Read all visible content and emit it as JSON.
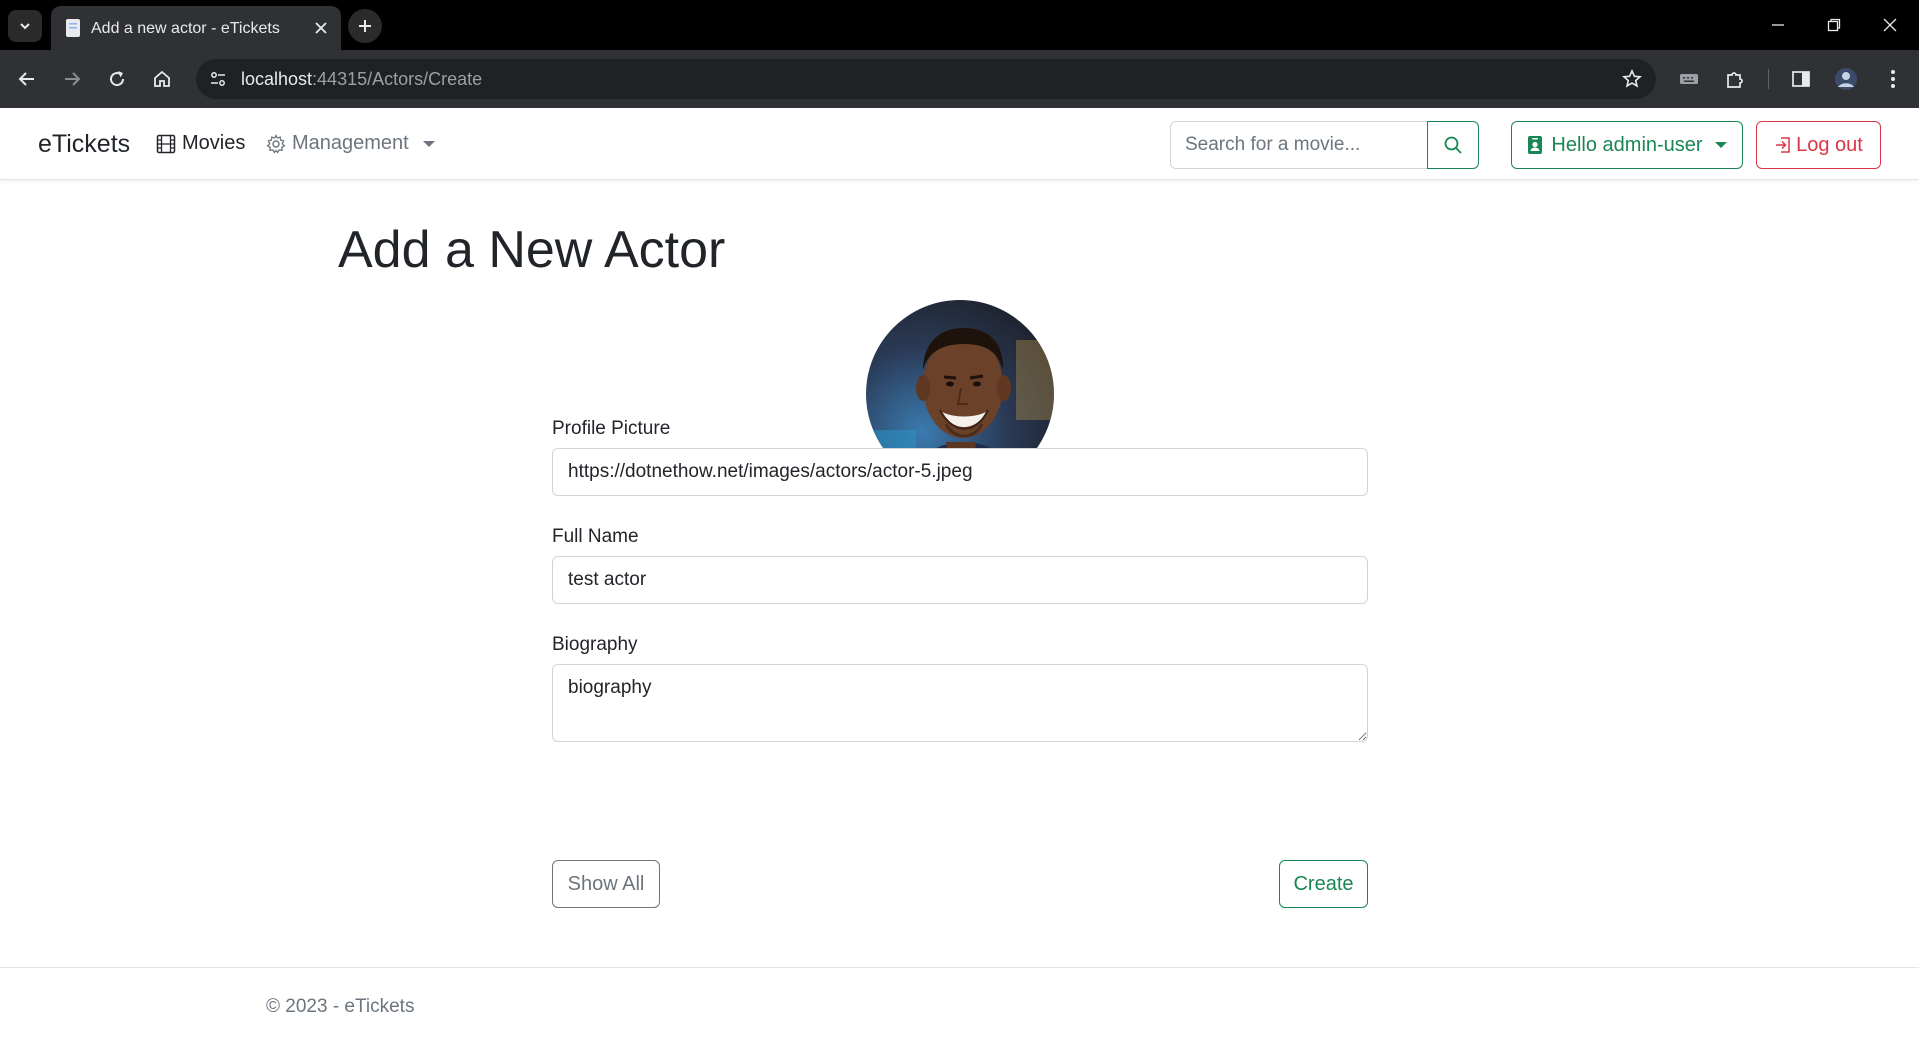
{
  "browser": {
    "tab_title": "Add a new actor - eTickets",
    "url_host": "localhost",
    "url_path": ":44315/Actors/Create"
  },
  "navbar": {
    "brand": "eTickets",
    "movies_label": "Movies",
    "management_label": "Management",
    "search_placeholder": "Search for a movie...",
    "user_label": "Hello admin-user",
    "logout_label": "Log out"
  },
  "form": {
    "title": "Add a New Actor",
    "profile_picture_label": "Profile Picture",
    "profile_picture_value": "https://dotnethow.net/images/actors/actor-5.jpeg",
    "full_name_label": "Full Name",
    "full_name_value": "test actor",
    "biography_label": "Biography",
    "biography_value": "biography",
    "show_all_label": "Show All",
    "create_label": "Create"
  },
  "footer": {
    "text": "© 2023 - eTickets"
  },
  "colors": {
    "success": "#198754",
    "danger": "#dc3545",
    "secondary": "#6c757d",
    "text": "#212529"
  }
}
